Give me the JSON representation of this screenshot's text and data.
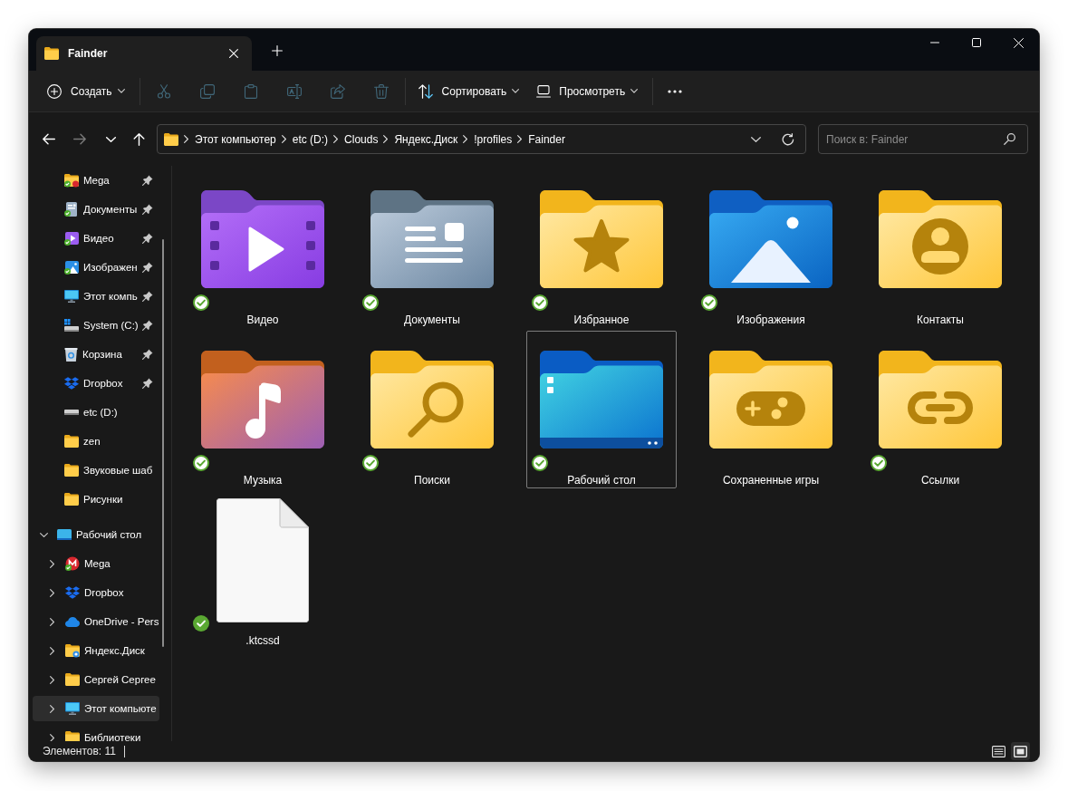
{
  "window": {
    "tab_title": "Fainder"
  },
  "toolbar": {
    "new_label": "Создать",
    "actions": [
      {
        "kind": "cut",
        "disabled": true
      },
      {
        "kind": "copy",
        "disabled": true
      },
      {
        "kind": "paste",
        "disabled": true
      },
      {
        "kind": "rename",
        "disabled": true
      },
      {
        "kind": "share",
        "disabled": true
      },
      {
        "kind": "delete",
        "disabled": true
      }
    ],
    "sort_label": "Сортировать",
    "view_label": "Просмотреть"
  },
  "navigation": {
    "buttons": [
      {
        "kind": "back",
        "disabled": false
      },
      {
        "kind": "forward",
        "disabled": true
      },
      {
        "kind": "recent",
        "disabled": false
      },
      {
        "kind": "up",
        "disabled": false
      }
    ]
  },
  "address_bar": {
    "path": [
      "Этот компьютер",
      "etc (D:)",
      "Clouds",
      "Яндекс.Диск",
      "!profiles",
      "Fainder"
    ]
  },
  "search": {
    "placeholder": "Поиск в: Fainder"
  },
  "sidebar": {
    "quick_access": [
      {
        "label": "Mega",
        "kind": "mega",
        "pinned": true
      },
      {
        "label": "Документы",
        "kind": "documents",
        "pinned": true
      },
      {
        "label": "Видео",
        "kind": "video",
        "pinned": true
      },
      {
        "label": "Изображен",
        "kind": "pictures",
        "pinned": true
      },
      {
        "label": "Этот компь",
        "kind": "computer",
        "pinned": true
      },
      {
        "label": "System (C:)",
        "kind": "system_drive",
        "pinned": true
      },
      {
        "label": "Корзина",
        "kind": "recycle_bin",
        "pinned": true
      },
      {
        "label": "Dropbox",
        "kind": "dropbox",
        "pinned": true
      },
      {
        "label": "etc (D:)",
        "kind": "drive",
        "pinned": false
      },
      {
        "label": "zen",
        "kind": "folder",
        "pinned": false
      },
      {
        "label": "Звуковые шаб",
        "kind": "folder",
        "pinned": false
      },
      {
        "label": "Рисунки",
        "kind": "folder",
        "pinned": false
      }
    ],
    "tree": [
      {
        "label": "Рабочий стол",
        "kind": "desktop",
        "expanded": true,
        "selected": false,
        "children": [
          {
            "label": "Mega",
            "kind": "mega_logo",
            "expanded": false,
            "selected": false
          },
          {
            "label": "Dropbox",
            "kind": "dropbox",
            "expanded": false,
            "selected": false
          },
          {
            "label": "OneDrive - Pers",
            "kind": "onedrive",
            "expanded": false,
            "selected": false
          },
          {
            "label": "Яндекс.Диск",
            "kind": "yandex_disk",
            "expanded": false,
            "selected": false
          },
          {
            "label": "Сергей Сергее",
            "kind": "folder",
            "expanded": false,
            "selected": false
          },
          {
            "label": "Этот компьюте",
            "kind": "computer",
            "expanded": false,
            "selected": true
          },
          {
            "label": "Библиотеки",
            "kind": "folder",
            "expanded": false,
            "selected": false
          }
        ]
      }
    ]
  },
  "items": [
    {
      "name": "Видео",
      "kind": "video",
      "synced": true,
      "always_on_device": false,
      "selected": false
    },
    {
      "name": "Документы",
      "kind": "documents",
      "synced": true,
      "always_on_device": false,
      "selected": false
    },
    {
      "name": "Избранное",
      "kind": "favorites",
      "synced": true,
      "always_on_device": false,
      "selected": false
    },
    {
      "name": "Изображения",
      "kind": "pictures",
      "synced": true,
      "always_on_device": false,
      "selected": false
    },
    {
      "name": "Контакты",
      "kind": "contacts",
      "synced": false,
      "selected": false
    },
    {
      "name": "Музыка",
      "kind": "music",
      "synced": true,
      "always_on_device": false,
      "selected": false
    },
    {
      "name": "Поиски",
      "kind": "searches",
      "synced": true,
      "always_on_device": false,
      "selected": false
    },
    {
      "name": "Рабочий стол",
      "kind": "desktop",
      "synced": true,
      "always_on_device": false,
      "selected": true
    },
    {
      "name": "Сохраненные игры",
      "kind": "games",
      "synced": false,
      "selected": false
    },
    {
      "name": "Ссылки",
      "kind": "links",
      "synced": true,
      "always_on_device": false,
      "selected": false
    },
    {
      "name": ".ktcssd",
      "kind": "file",
      "synced": true,
      "always_on_device": true,
      "selected": false
    }
  ],
  "status_bar": {
    "item_count": "Элементов: 11",
    "view_buttons": [
      {
        "kind": "details",
        "selected": false
      },
      {
        "kind": "large_icons",
        "selected": true
      }
    ]
  }
}
